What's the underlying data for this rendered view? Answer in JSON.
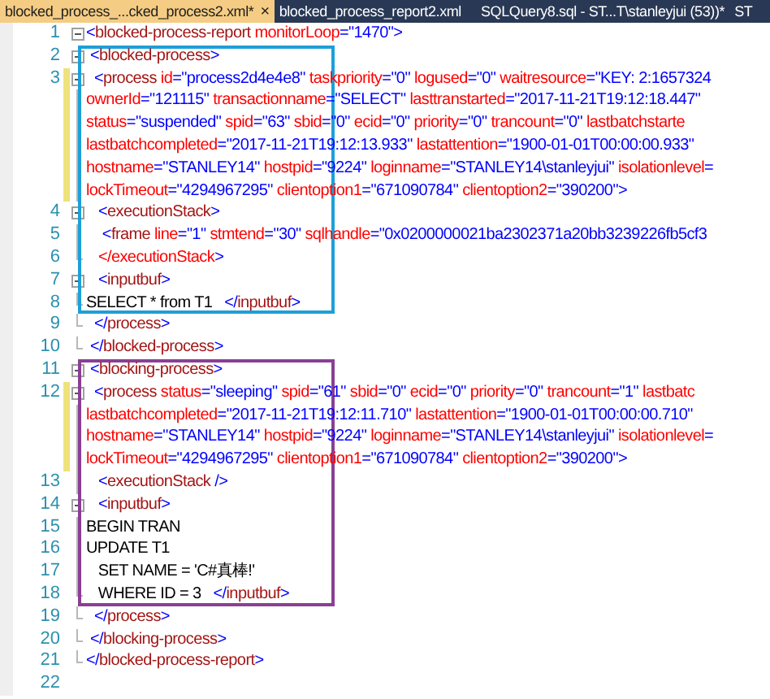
{
  "tabs": [
    {
      "label": "blocked_process_...cked_process2.xml*",
      "close": "×",
      "selected": true
    },
    {
      "label": "blocked_process_report2.xml",
      "selected": false
    },
    {
      "label": "SQLQuery8.sql - ST...T\\stanleyjui (53))*",
      "selected": false
    },
    {
      "label": "ST",
      "selected": false
    }
  ],
  "sections": [
    {
      "lines": [
        {
          "number": "1",
          "kind": "collapse",
          "modified": false,
          "rows": [
            "<blocked-process-report monitorLoop=\"1470\">"
          ]
        }
      ]
    },
    {
      "color": "#1e9fd8",
      "lines": [
        {
          "number": "2",
          "kind": "collapse",
          "modified": false,
          "rows": [
            " <blocked-process>"
          ]
        },
        {
          "number": "3",
          "kind": "collapse",
          "modified": true,
          "rows": [
            "  <process id=\"process2d4e4e8\" taskpriority=\"0\" logused=\"0\" waitresource=\"KEY: 2:1657324",
            "ownerId=\"121115\" transactionname=\"SELECT\" lasttranstarted=\"2017-11-21T19:12:18.447\"",
            "status=\"suspended\" spid=\"63\" sbid=\"0\" ecid=\"0\" priority=\"0\" trancount=\"0\" lastbatchstarte",
            "lastbatchcompleted=\"2017-11-21T19:12:13.933\" lastattention=\"1900-01-01T00:00:00.933\"",
            "hostname=\"STANLEY14\" hostpid=\"9224\" loginname=\"STANLEY14\\stanleyjui\" isolationlevel=",
            "lockTimeout=\"4294967295\" clientoption1=\"671090784\" clientoption2=\"390200\">"
          ]
        },
        {
          "number": "4",
          "kind": "collapse",
          "modified": false,
          "rows": [
            "   <executionStack>"
          ]
        },
        {
          "number": "5",
          "kind": "guide",
          "modified": false,
          "rows": [
            "    <frame line=\"1\" stmtend=\"30\" sqlhandle=\"0x0200000021ba2302371a20bb3239226fb5cf3"
          ]
        },
        {
          "number": "6",
          "kind": "end",
          "modified": false,
          "rows": [
            "   </executionStack>"
          ]
        },
        {
          "number": "7",
          "kind": "collapse",
          "modified": false,
          "rows": [
            "   <inputbuf>"
          ]
        },
        {
          "number": "8",
          "kind": "end",
          "modified": false,
          "rows": [
            "SELECT * from T1   </inputbuf>"
          ]
        }
      ]
    },
    {
      "lines": [
        {
          "number": "9",
          "kind": "end",
          "modified": false,
          "rows": [
            "  </process>"
          ]
        },
        {
          "number": "10",
          "kind": "end",
          "modified": false,
          "rows": [
            " </blocked-process>"
          ]
        }
      ]
    },
    {
      "color": "#8a3f94",
      "lines": [
        {
          "number": "11",
          "kind": "collapse",
          "modified": false,
          "rows": [
            " <blocking-process>"
          ]
        },
        {
          "number": "12",
          "kind": "collapse",
          "modified": true,
          "rows": [
            "  <process status=\"sleeping\" spid=\"61\" sbid=\"0\" ecid=\"0\" priority=\"0\" trancount=\"1\" lastbatc",
            "lastbatchcompleted=\"2017-11-21T19:12:11.710\" lastattention=\"1900-01-01T00:00:00.710\"",
            "hostname=\"STANLEY14\" hostpid=\"9224\" loginname=\"STANLEY14\\stanleyjui\" isolationlevel=",
            "lockTimeout=\"4294967295\" clientoption1=\"671090784\" clientoption2=\"390200\">"
          ]
        },
        {
          "number": "13",
          "kind": "guide",
          "modified": false,
          "rows": [
            "   <executionStack />"
          ]
        },
        {
          "number": "14",
          "kind": "collapse",
          "modified": false,
          "rows": [
            "   <inputbuf>"
          ]
        },
        {
          "number": "15",
          "kind": "guide",
          "modified": false,
          "rows": [
            "BEGIN TRAN"
          ]
        },
        {
          "number": "16",
          "kind": "guide",
          "modified": false,
          "rows": [
            "UPDATE T1"
          ]
        },
        {
          "number": "17",
          "kind": "guide",
          "modified": false,
          "rows": [
            "   SET NAME = 'C#真棒!'"
          ]
        },
        {
          "number": "18",
          "kind": "end",
          "modified": false,
          "rows": [
            "   WHERE ID = 3   </inputbuf>"
          ]
        }
      ]
    },
    {
      "lines": [
        {
          "number": "19",
          "kind": "end",
          "modified": false,
          "rows": [
            "  </process>"
          ]
        },
        {
          "number": "20",
          "kind": "end",
          "modified": false,
          "rows": [
            " </blocking-process>"
          ]
        },
        {
          "number": "21",
          "kind": "end",
          "modified": false,
          "rows": [
            "</blocked-process-report>"
          ]
        },
        {
          "number": "22",
          "kind": "plain",
          "modified": false
        }
      ]
    }
  ]
}
